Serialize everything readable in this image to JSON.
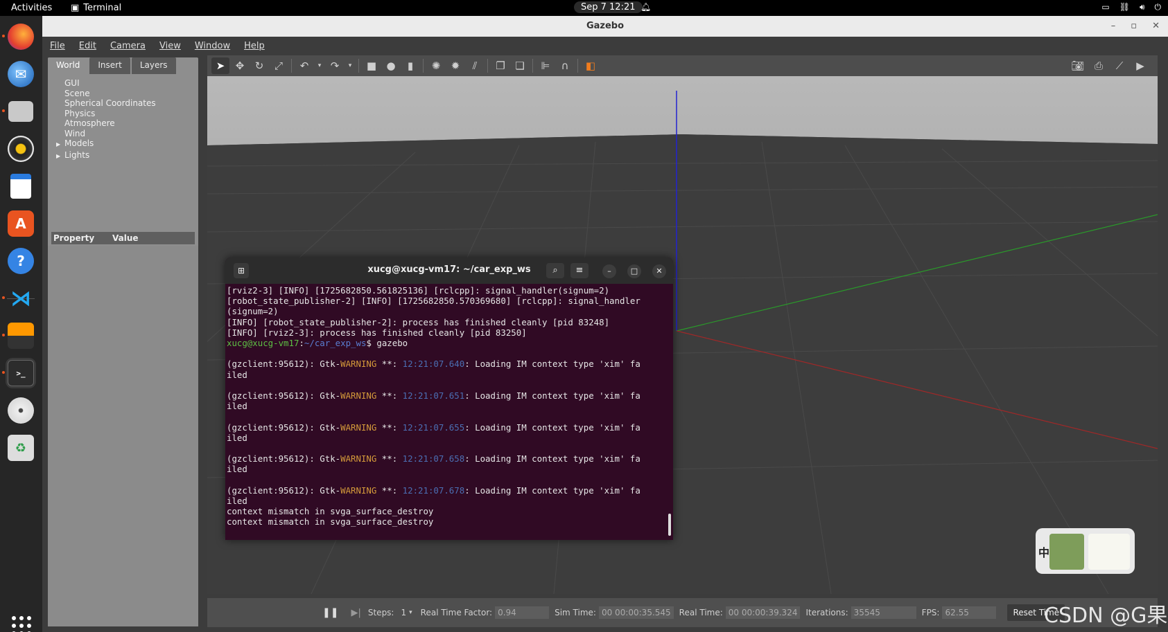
{
  "topbar": {
    "activities": "Activities",
    "app_name": "Terminal",
    "clock": "Sep 7  12:21"
  },
  "dock": {
    "items": [
      "firefox-icon",
      "thunderbird-icon",
      "files-icon",
      "rhythmbox-icon",
      "writer-icon",
      "software-icon",
      "help-icon",
      "vscode-icon",
      "sublime-icon",
      "terminal-icon",
      "disc-icon",
      "trash-icon"
    ]
  },
  "gazebo": {
    "window_title": "Gazebo",
    "menu": [
      "File",
      "Edit",
      "Camera",
      "View",
      "Window",
      "Help"
    ],
    "tabs": [
      "World",
      "Insert",
      "Layers"
    ],
    "tree": [
      "GUI",
      "Scene",
      "Spherical Coordinates",
      "Physics",
      "Atmosphere",
      "Wind"
    ],
    "tree_expandable": [
      "Models",
      "Lights"
    ],
    "property_header": "Property",
    "value_header": "Value",
    "status": {
      "steps_label": "Steps:",
      "steps_value": "1",
      "rtf_label": "Real Time Factor:",
      "rtf_value": "0.94",
      "sim_time_label": "Sim Time:",
      "sim_time_value": "00 00:00:35.545",
      "real_time_label": "Real Time:",
      "real_time_value": "00 00:00:39.324",
      "iterations_label": "Iterations:",
      "iterations_value": "35545",
      "fps_label": "FPS:",
      "fps_value": "62.55",
      "reset_label": "Reset Time"
    }
  },
  "terminal": {
    "title": "xucg@xucg-vm17: ~/car_exp_ws",
    "lines": {
      "l1": "[rviz2-3] [INFO] [1725682850.561825136] [rclcpp]: signal_handler(signum=2)",
      "l2": "[robot_state_publisher-2] [INFO] [1725682850.570369680] [rclcpp]: signal_handler",
      "l3": "(signum=2)",
      "l4": "[INFO] [robot_state_publisher-2]: process has finished cleanly [pid 83248]",
      "l5": "[INFO] [rviz2-3]: process has finished cleanly [pid 83250]",
      "prompt_user": "xucg@xucg-vm17",
      "prompt_sep": ":",
      "prompt_path": "~/car_exp_ws",
      "prompt_cmd": "$ gazebo",
      "warn_prefix": "(gzclient:95612): Gtk-",
      "warn_word": "WARNING",
      "warn_stars": " **: ",
      "ts1": "12:21:07.640",
      "ts2": "12:21:07.651",
      "ts3": "12:21:07.655",
      "ts4": "12:21:07.658",
      "ts5": "12:21:07.678",
      "warn_msg": ": Loading IM context type 'xim' fa",
      "warn_tail": "iled",
      "ctx1": "context mismatch in svga_surface_destroy",
      "ctx2": "context mismatch in svga_surface_destroy"
    }
  },
  "widget": {
    "char": "中"
  },
  "watermark": "CSDN @G果"
}
